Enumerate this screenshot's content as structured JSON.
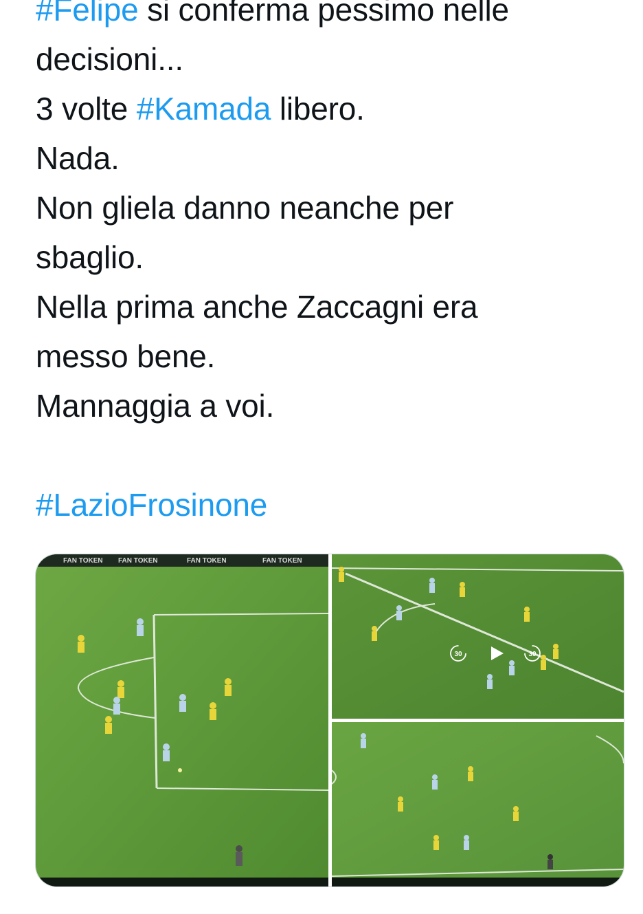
{
  "tweet": {
    "lines": [
      {
        "parts": [
          {
            "text": "#Felipe",
            "hashtag": true
          },
          {
            "text": " si conferma pessimo nelle",
            "hashtag": false
          }
        ]
      },
      {
        "parts": [
          {
            "text": "decisioni...",
            "hashtag": false
          }
        ]
      },
      {
        "parts": [
          {
            "text": "3 volte ",
            "hashtag": false
          },
          {
            "text": "#Kamada",
            "hashtag": true
          },
          {
            "text": " libero.",
            "hashtag": false
          }
        ]
      },
      {
        "parts": [
          {
            "text": "Nada.",
            "hashtag": false
          }
        ]
      },
      {
        "parts": [
          {
            "text": "Non gliela danno neanche per",
            "hashtag": false
          }
        ]
      },
      {
        "parts": [
          {
            "text": "sbaglio.",
            "hashtag": false
          }
        ]
      },
      {
        "parts": [
          {
            "text": "Nella prima anche Zaccagni era",
            "hashtag": false
          }
        ]
      },
      {
        "parts": [
          {
            "text": "messo bene.",
            "hashtag": false
          }
        ]
      },
      {
        "parts": [
          {
            "text": "Mannaggia a voi.",
            "hashtag": false
          }
        ]
      }
    ],
    "hashtag_footer": "#LazioFrosinone"
  },
  "media": {
    "ad_banner_text": "FAN TOKEN",
    "video_controls": {
      "rewind_label": "30",
      "forward_label": "30"
    }
  },
  "colors": {
    "hashtag": "#1d9bf0",
    "text": "#0f1419",
    "pitch": "#5e9a3a",
    "pitch_light": "#7fb552"
  }
}
